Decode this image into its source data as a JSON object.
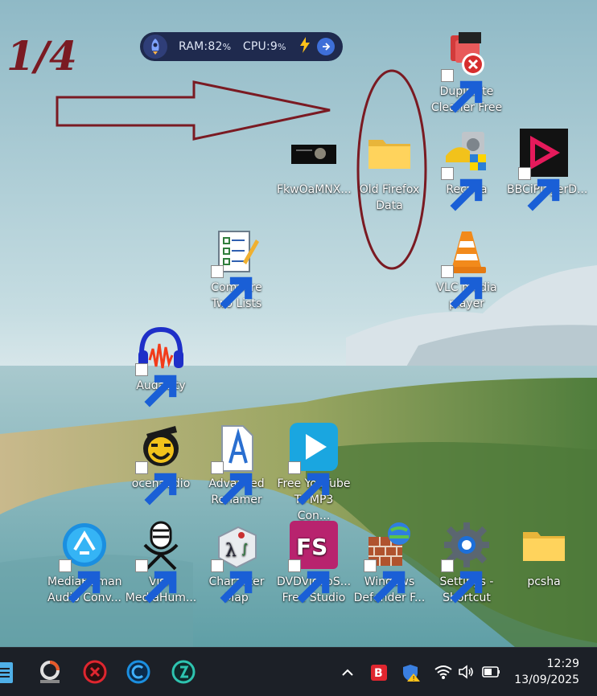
{
  "annotation": {
    "label": "1/4",
    "arrow_color": "#7a1a22",
    "ellipse_color": "#7a1a22"
  },
  "widget": {
    "ram": "RAM:82",
    "cpu": "CPU:9",
    "unit": "%"
  },
  "desktop_icons": {
    "duplicate_cleaner": "Duplicate Cleaner Free",
    "fkwoa": "FkwOaMNX...",
    "old_firefox": "Old Firefox Data",
    "recuva": "Recuva",
    "bbciplayer": "BBCiPlayerD...",
    "compare_lists": "Compare Two Lists",
    "vlc": "VLC media player",
    "audacity": "Audacity",
    "ocenaudio": "ocenaudio",
    "advanced_renamer": "Advanced Renamer",
    "free_youtube": "Free YouTube To MP3 Con...",
    "mediahuman": "MediaHuman Audio Conv...",
    "visit_mediahuman": "Visit MediaHum...",
    "character_map": "Character Map",
    "dvdvideosoft": "DVDVideoS... Free Studio",
    "windows_defender": "Windows Defender F...",
    "settings": "Settings - Shortcut",
    "pcsha": "pcsha"
  },
  "taskbar": {
    "time": "12:29",
    "date": "13/09/2025",
    "apps": [
      "notepad-icon",
      "photoscape-icon",
      "red-app-icon",
      "ccleaner-icon",
      "teal-app-icon"
    ],
    "tray": [
      "chevron-up-icon",
      "antivirus-icon",
      "security-icon",
      "wifi-icon",
      "volume-icon",
      "battery-icon"
    ]
  }
}
